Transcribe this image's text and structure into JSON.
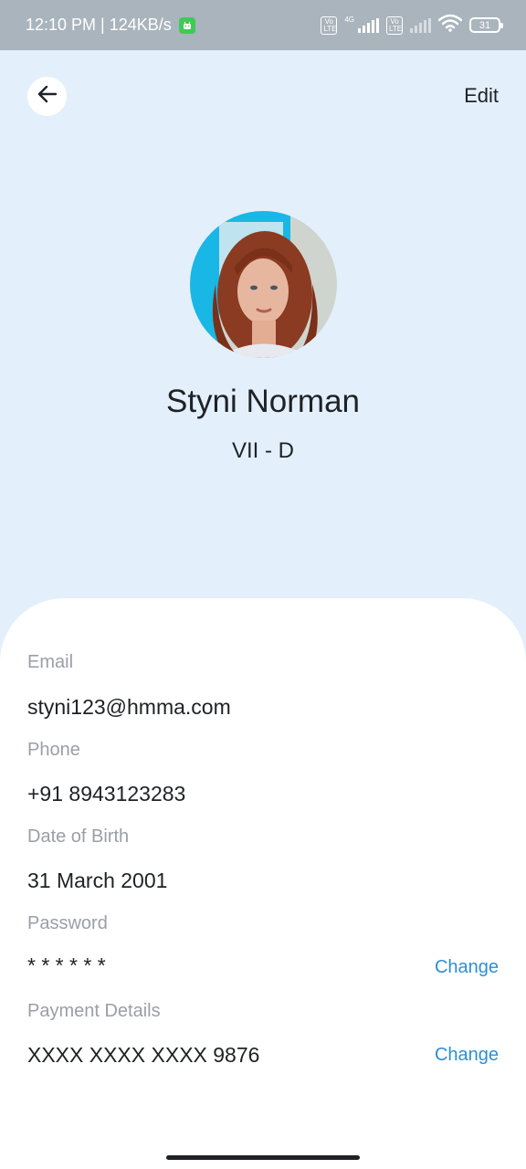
{
  "status_bar": {
    "time_speed": "12:10 PM | 124KB/s",
    "network_label": "4G",
    "volte_label": "Vo LTE",
    "battery": "31"
  },
  "header": {
    "edit_label": "Edit"
  },
  "profile": {
    "name": "Styni Norman",
    "class_section": "VII - D"
  },
  "details": {
    "email_label": "Email",
    "email_value": "styni123@hmma.com",
    "phone_label": "Phone",
    "phone_value": "+91 8943123283",
    "dob_label": "Date of Birth",
    "dob_value": "31 March 2001",
    "password_label": "Password",
    "password_value": "* * * * * *",
    "password_change": "Change",
    "payment_label": "Payment Details",
    "payment_value": "XXXX XXXX XXXX 9876",
    "payment_change": "Change"
  },
  "colors": {
    "background": "#e3f0fb",
    "status_bar": "#aab4bd",
    "accent_link": "#2b8fd6",
    "label_gray": "#9a9ea6"
  }
}
